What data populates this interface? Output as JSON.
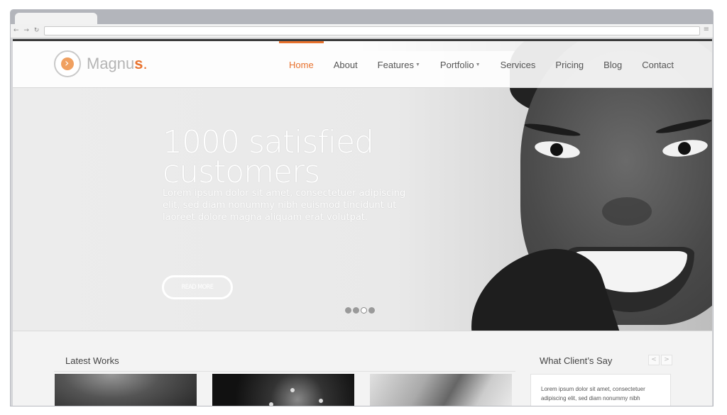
{
  "browser": {
    "nav_glyphs": "← → ↻",
    "menu_glyph": "≡"
  },
  "brand": {
    "name_main": "Magnu",
    "name_accent": "s",
    "name_dot": "."
  },
  "nav": {
    "items": [
      {
        "label": "Home",
        "active": true
      },
      {
        "label": "About"
      },
      {
        "label": "Features",
        "dropdown": true
      },
      {
        "label": "Portfolio",
        "dropdown": true
      },
      {
        "label": "Services"
      },
      {
        "label": "Pricing"
      },
      {
        "label": "Blog"
      },
      {
        "label": "Contact"
      }
    ],
    "caret": "▼"
  },
  "hero": {
    "headline": "1000 satisfied customers",
    "body": "Lorem ipsum dolor sit amet, consectetuer adipiscing elit, sed diam nonummy nibh euismod tincidunt ut laoreet dolore magna aliquam erat volutpat.",
    "button": "READ MORE",
    "slides": 4,
    "active_slide": 3
  },
  "works": {
    "title": "Latest Works"
  },
  "testimonials": {
    "title": "What Client’s Say",
    "prev": "<",
    "next": ">",
    "quote": "Lorem ipsum dolor sit amet, consectetuer adipiscing elit, sed diam nonummy nibh"
  },
  "colors": {
    "accent": "#e8722e",
    "nav_text": "#555555",
    "hero_text": "#ffffff"
  }
}
